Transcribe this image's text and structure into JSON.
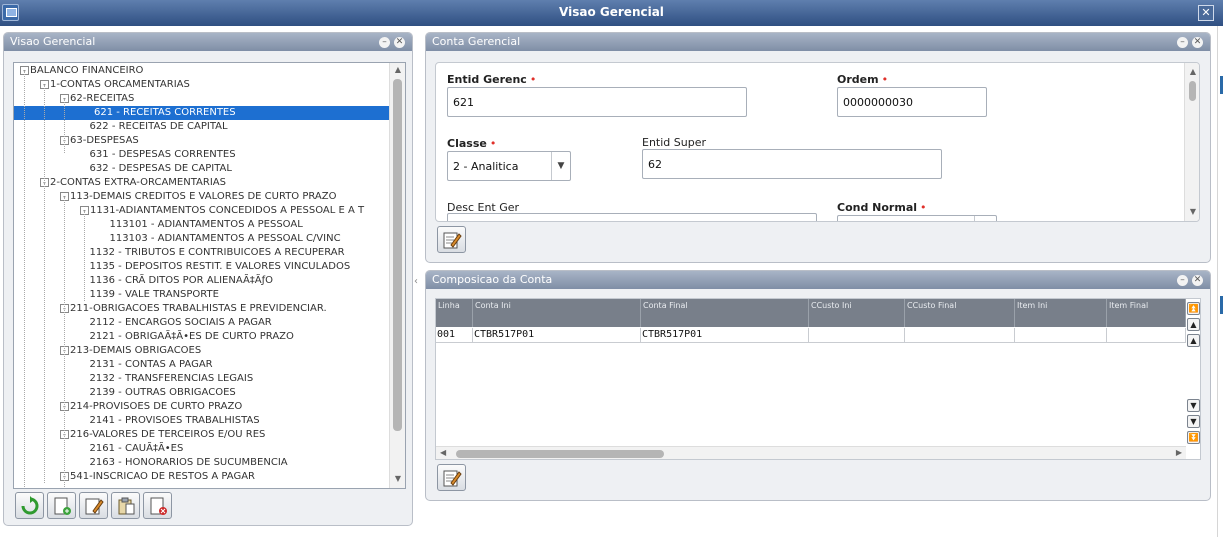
{
  "window": {
    "title": "Visao Gerencial"
  },
  "left_panel": {
    "title": "Visao Gerencial",
    "tree": [
      {
        "label": "BALANCO FINANCEIRO",
        "level": 0,
        "toggle": "-"
      },
      {
        "label": "1-CONTAS ORCAMENTARIAS",
        "level": 1,
        "toggle": "-"
      },
      {
        "label": "62-RECEITAS",
        "level": 2,
        "toggle": "-"
      },
      {
        "label": "621 - RECEITAS CORRENTES",
        "level": 3,
        "toggle": "",
        "selected": true
      },
      {
        "label": "622 - RECEITAS DE CAPITAL",
        "level": 3,
        "toggle": ""
      },
      {
        "label": "63-DESPESAS",
        "level": 2,
        "toggle": "-"
      },
      {
        "label": "631 - DESPESAS CORRENTES",
        "level": 3,
        "toggle": ""
      },
      {
        "label": "632 - DESPESAS DE CAPITAL",
        "level": 3,
        "toggle": ""
      },
      {
        "label": "2-CONTAS EXTRA-ORCAMENTARIAS",
        "level": 1,
        "toggle": "-"
      },
      {
        "label": "113-DEMAIS CREDITOS E VALORES DE CURTO PRAZO",
        "level": 2,
        "toggle": "-"
      },
      {
        "label": "1131-ADIANTAMENTOS CONCEDIDOS A PESSOAL E A T",
        "level": 3,
        "toggle": "-"
      },
      {
        "label": "113101 - ADIANTAMENTOS A PESSOAL",
        "level": 4,
        "toggle": ""
      },
      {
        "label": "113103 - ADIANTAMENTOS A PESSOAL C/VINC",
        "level": 4,
        "toggle": ""
      },
      {
        "label": "1132 - TRIBUTOS E CONTRIBUICOES A RECUPERAR",
        "level": 3,
        "toggle": ""
      },
      {
        "label": "1135 - DEPOSITOS RESTIT. E VALORES VINCULADOS",
        "level": 3,
        "toggle": ""
      },
      {
        "label": "1136 - CRÃ DITOS POR ALIENAÃ‡ÃƒO",
        "level": 3,
        "toggle": ""
      },
      {
        "label": "1139 - VALE TRANSPORTE",
        "level": 3,
        "toggle": ""
      },
      {
        "label": "211-OBRIGACOES TRABALHISTAS E PREVIDENCIAR.",
        "level": 2,
        "toggle": "-"
      },
      {
        "label": "2112 - ENCARGOS SOCIAIS A PAGAR",
        "level": 3,
        "toggle": ""
      },
      {
        "label": "2121 - OBRIGAÃ‡Ã•ES DE CURTO PRAZO",
        "level": 3,
        "toggle": ""
      },
      {
        "label": "213-DEMAIS OBRIGACOES",
        "level": 2,
        "toggle": "-"
      },
      {
        "label": "2131 - CONTAS A PAGAR",
        "level": 3,
        "toggle": ""
      },
      {
        "label": "2132 - TRANSFERENCIAS LEGAIS",
        "level": 3,
        "toggle": ""
      },
      {
        "label": "2139 - OUTRAS OBRIGACOES",
        "level": 3,
        "toggle": ""
      },
      {
        "label": "214-PROVISOES DE CURTO PRAZO",
        "level": 2,
        "toggle": "-"
      },
      {
        "label": "2141 - PROVISOES TRABALHISTAS",
        "level": 3,
        "toggle": ""
      },
      {
        "label": "216-VALORES DE TERCEIROS E/OU RES",
        "level": 2,
        "toggle": "-"
      },
      {
        "label": "2161 - CAUÃ‡Ã•ES",
        "level": 3,
        "toggle": ""
      },
      {
        "label": "2163 - HONORARIOS DE SUCUMBENCIA",
        "level": 3,
        "toggle": ""
      },
      {
        "label": "541-INSCRICAO DE RESTOS A PAGAR",
        "level": 2,
        "toggle": "-"
      }
    ],
    "toolbar": [
      {
        "name": "refresh-button",
        "icon": "refresh-icon"
      },
      {
        "name": "add-button",
        "icon": "add-document-icon"
      },
      {
        "name": "edit-button",
        "icon": "edit-icon"
      },
      {
        "name": "clipboard-button",
        "icon": "clipboard-icon"
      },
      {
        "name": "delete-button",
        "icon": "delete-document-icon"
      }
    ]
  },
  "conta_panel": {
    "title": "Conta Gerencial",
    "fields": {
      "entid_gerenc": {
        "label": "Entid Gerenc",
        "value": "621",
        "required": "•"
      },
      "ordem": {
        "label": "Ordem",
        "value": "0000000030",
        "required": "•"
      },
      "classe": {
        "label": "Classe",
        "value": "2 - Analitica",
        "required": "•"
      },
      "entid_super": {
        "label": "Entid Super",
        "value": "62"
      },
      "desc_ent_ger": {
        "label": "Desc Ent Ger",
        "value": ""
      },
      "cond_normal": {
        "label": "Cond Normal",
        "value": "",
        "required": "•"
      }
    }
  },
  "comp_panel": {
    "title": "Composicao da Conta",
    "columns": [
      "Linha",
      "Conta Ini",
      "Conta Final",
      "CCusto Ini",
      "CCusto Final",
      "Item Ini",
      "Item Final"
    ],
    "rows": [
      [
        "001",
        "CTBR517P01",
        "CTBR517P01",
        "",
        "",
        "",
        ""
      ]
    ]
  },
  "colors": {
    "titlebar": "#2f4f82",
    "panel_header": "#8e9bb1",
    "selection": "#1d6fd1",
    "required": "#e0302a"
  }
}
